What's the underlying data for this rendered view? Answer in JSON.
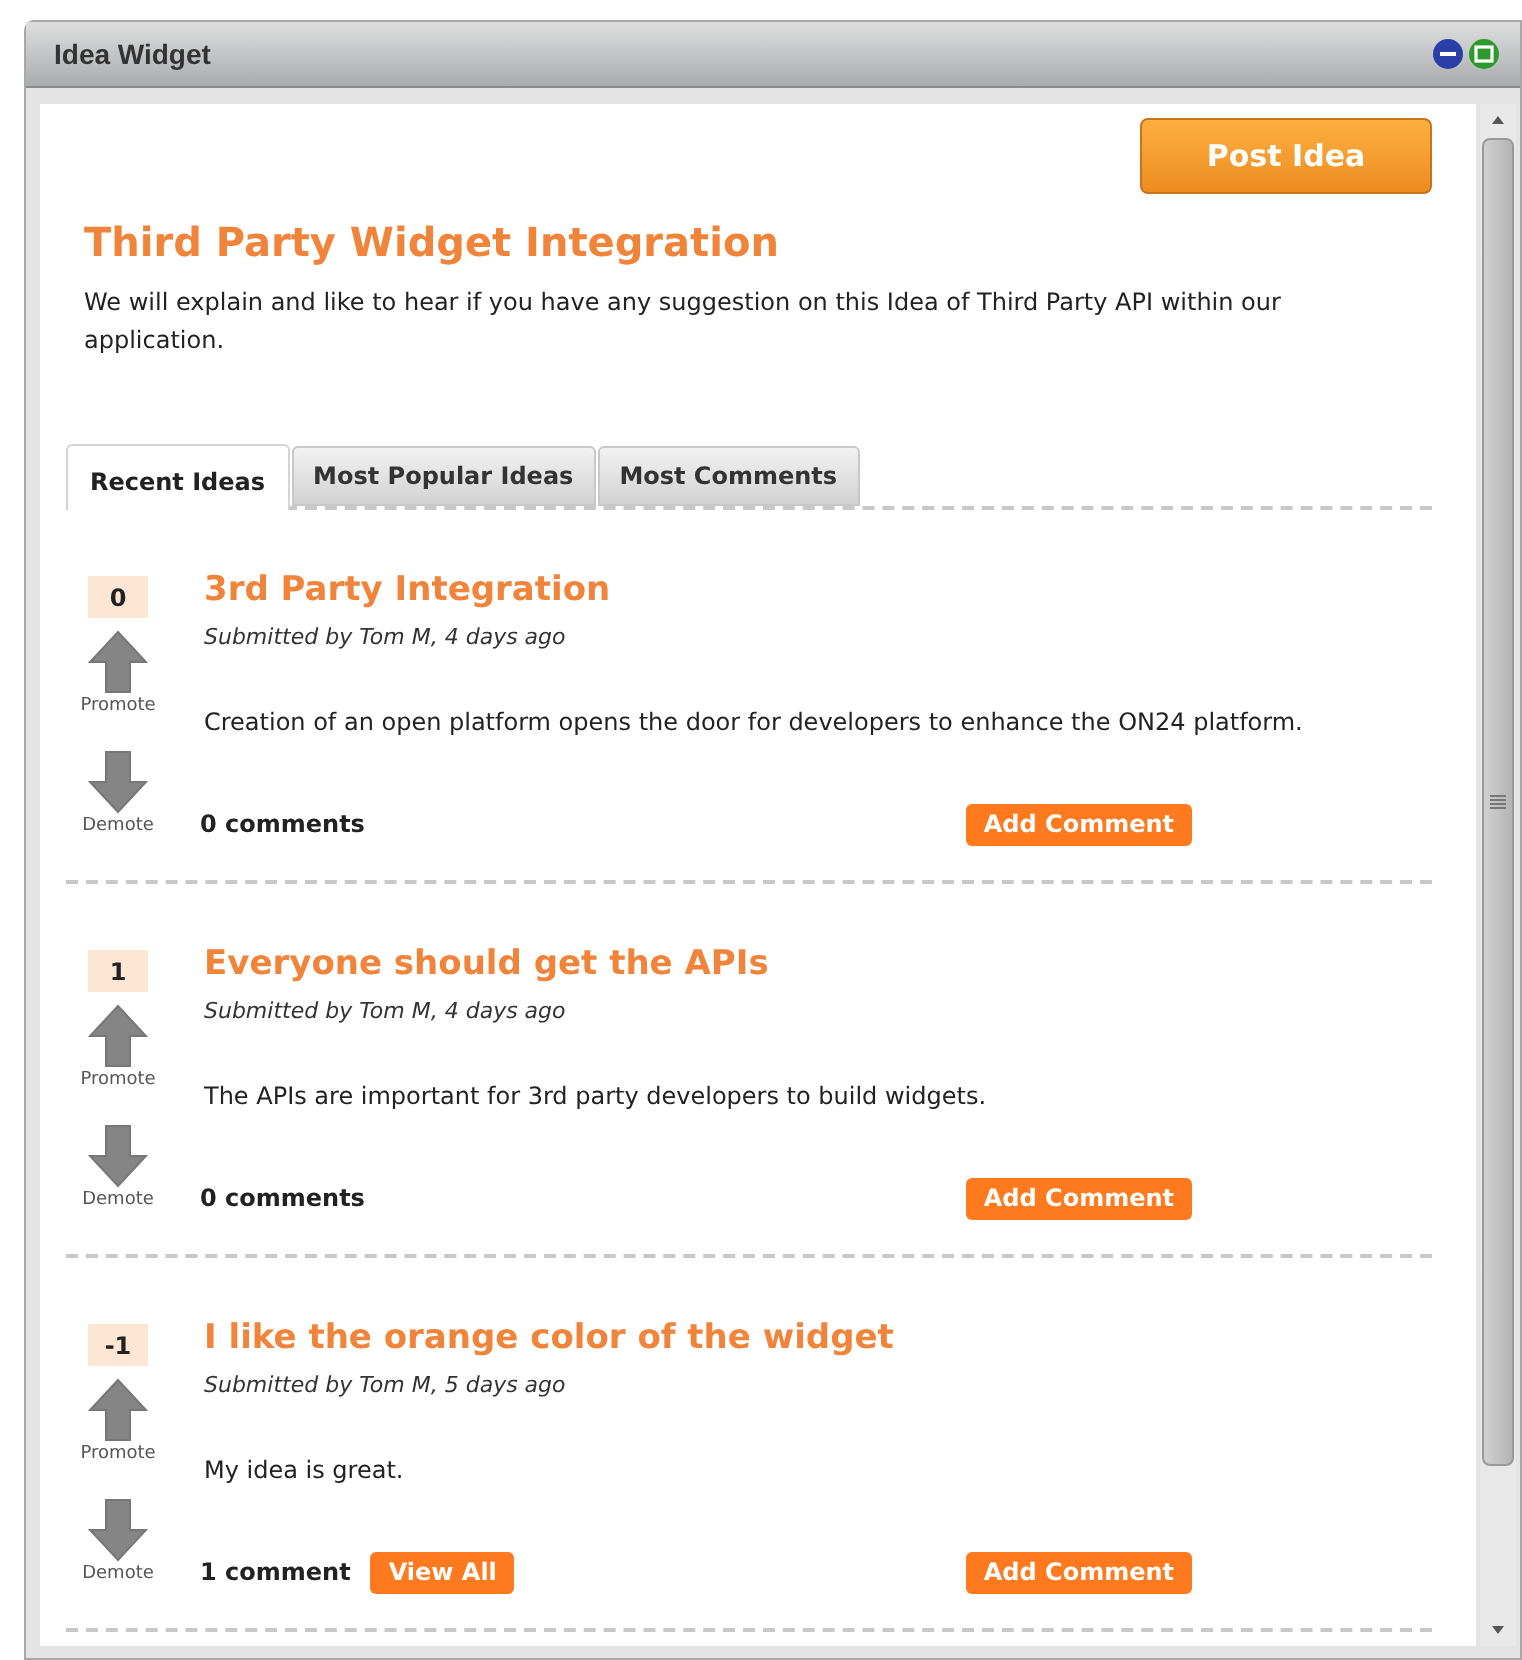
{
  "window": {
    "title": "Idea Widget"
  },
  "post_button": "Post Idea",
  "heading": "Third Party Widget Integration",
  "description": "We will explain and like to hear if you have any suggestion on this Idea of Third Party API within our application.",
  "tabs": [
    {
      "label": "Recent Ideas",
      "selected": true
    },
    {
      "label": "Most Popular Ideas",
      "selected": false
    },
    {
      "label": "Most Comments",
      "selected": false
    }
  ],
  "ideas": [
    {
      "score": "0",
      "promote": "Promote",
      "demote": "Demote",
      "title": "3rd Party Integration",
      "meta": "Submitted by Tom M, 4 days ago",
      "body": "Creation of an open platform opens the door for developers to enhance the ON24 platform.",
      "comments": "0 comments",
      "add_comment": "Add Comment"
    },
    {
      "score": "1",
      "promote": "Promote",
      "demote": "Demote",
      "title": "Everyone should get the APIs",
      "meta": "Submitted by Tom M, 4 days ago",
      "body": "The APIs are important for 3rd party developers to build widgets.",
      "comments": "0 comments",
      "add_comment": "Add Comment"
    },
    {
      "score": "-1",
      "promote": "Promote",
      "demote": "Demote",
      "title": "I like the orange color of the widget",
      "meta": "Submitted by Tom M, 5 days ago",
      "body": "My idea is great.",
      "comments": "1 comment",
      "view_all": "View All",
      "add_comment": "Add Comment"
    }
  ]
}
